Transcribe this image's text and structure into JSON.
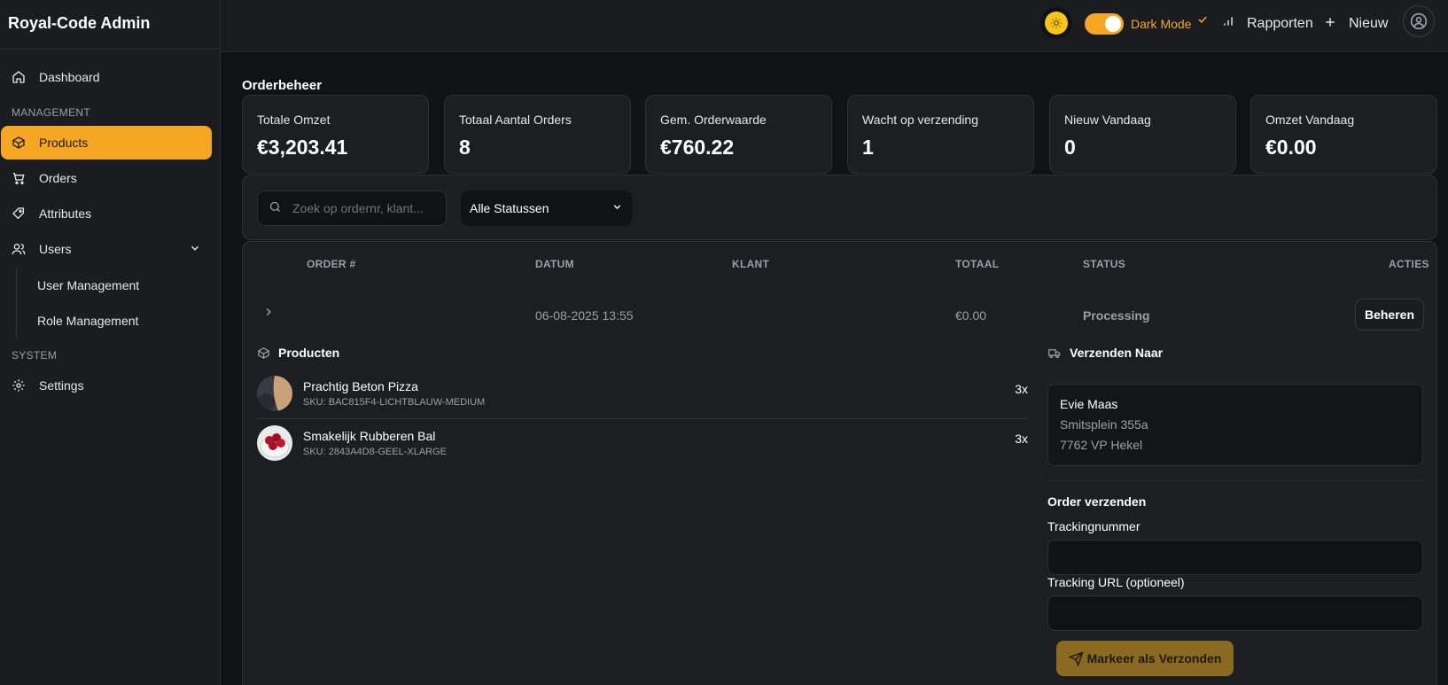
{
  "app": {
    "title": "Royal-Code Admin"
  },
  "sidebar": {
    "dashboard": "Dashboard",
    "management_label": "MANAGEMENT",
    "items": [
      {
        "label": "Products",
        "icon": "box-icon",
        "active": true
      },
      {
        "label": "Orders",
        "icon": "cart-icon"
      },
      {
        "label": "Attributes",
        "icon": "tag-icon"
      },
      {
        "label": "Users",
        "icon": "users-icon"
      }
    ],
    "sub_items": [
      "User Management",
      "Role Management"
    ],
    "system_label": "SYSTEM",
    "settings": "Settings"
  },
  "topbar": {
    "theme_toggle_label": "Dark Mode",
    "reports_label": "Rapporten",
    "new_label": "Nieuw",
    "accent": "#f5a623"
  },
  "page": {
    "title": "Orderbeheer"
  },
  "stats": [
    {
      "label": "Totale Omzet",
      "value": "€3,203.41"
    },
    {
      "label": "Totaal Aantal Orders",
      "value": "8"
    },
    {
      "label": "Gem. Orderwaarde",
      "value": "€760.22"
    },
    {
      "label": "Wacht op verzending",
      "value": "1"
    },
    {
      "label": "Nieuw Vandaag",
      "value": "0"
    },
    {
      "label": "Omzet Vandaag",
      "value": "€0.00"
    }
  ],
  "filters": {
    "search_placeholder": "Zoek op ordernr, klant...",
    "status_select": "Alle Statussen"
  },
  "table": {
    "columns": [
      "ORDER #",
      "DATUM",
      "KLANT",
      "TOTAAL",
      "STATUS",
      "ACTIES"
    ],
    "row": {
      "order": "",
      "date": "06-08-2025 13:55",
      "customer": "",
      "total": "€0.00",
      "status": "Processing",
      "action": "Beheren"
    }
  },
  "details": {
    "products_title": "Producten",
    "products": [
      {
        "name": "Prachtig Beton Pizza",
        "sku": "SKU: BAC815F4-LICHTBLAUW-MEDIUM",
        "qty": "3x"
      },
      {
        "name": "Smakelijk Rubberen Bal",
        "sku": "SKU: 2843A4D8-GEEL-XLARGE",
        "qty": "3x"
      }
    ],
    "shipping_title": "Verzenden Naar",
    "address": {
      "name": "Evie Maas",
      "street": "Smitsplein 355a",
      "city": "7762 VP Hekel"
    },
    "ship_form_title": "Order verzenden",
    "tracking_label": "Trackingnummer",
    "tracking_url_label": "Tracking URL (optioneel)",
    "ship_button": "Markeer als Verzonden"
  }
}
